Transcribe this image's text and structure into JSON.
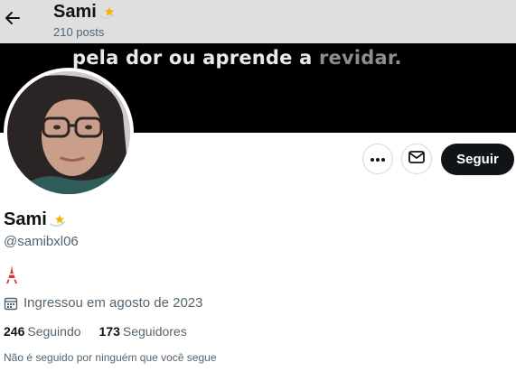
{
  "header": {
    "title": "Sami",
    "posts_count": "210 posts"
  },
  "banner": {
    "text_main": "pela dor ou aprende a ",
    "text_dim": "revidar."
  },
  "actions": {
    "follow_label": "Seguir"
  },
  "profile": {
    "name": "Sami",
    "handle": "@samibxl06",
    "bio_icon": "tokyo-tower-emoji",
    "joined": "Ingressou em agosto de 2023",
    "following_count": "246",
    "following_label": "Seguindo",
    "followers_count": "173",
    "followers_label": "Seguidores",
    "followed_by_note": "Não é seguido por ninguém que você segue"
  },
  "icons": {
    "back": "arrow-left-icon",
    "name_emoji": "dizzy-star-emoji",
    "more": "ellipsis-icon",
    "message": "envelope-icon",
    "calendar": "calendar-icon"
  },
  "colors": {
    "text_primary": "#0f1419",
    "text_secondary": "#536471",
    "button_dark": "#0f1419",
    "border": "#cfd9de",
    "star": "#f5b400"
  }
}
